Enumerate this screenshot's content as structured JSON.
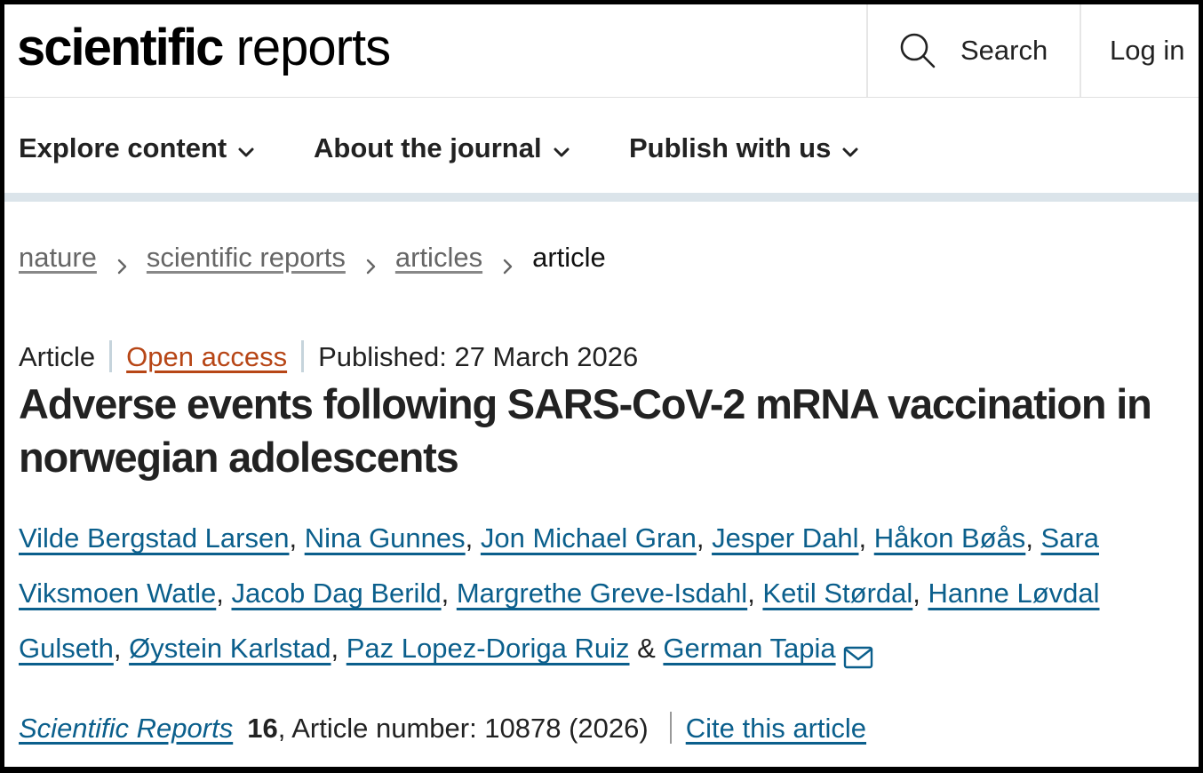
{
  "header": {
    "logo_bold": "scientific",
    "logo_light": "reports",
    "search_label": "Search",
    "login_label": "Log in"
  },
  "nav": {
    "items": [
      {
        "label": "Explore content"
      },
      {
        "label": "About the journal"
      },
      {
        "label": "Publish with us"
      }
    ]
  },
  "breadcrumb": {
    "items": [
      {
        "label": "nature"
      },
      {
        "label": "scientific reports"
      },
      {
        "label": "articles"
      }
    ],
    "current": "article"
  },
  "article": {
    "type": "Article",
    "access": "Open access",
    "published": "Published: 27 March 2026",
    "title": "Adverse events following SARS-CoV-2 mRNA vaccination in norwegian adolescents",
    "authors": [
      "Vilde Bergstad Larsen",
      "Nina Gunnes",
      "Jon Michael Gran",
      "Jesper Dahl",
      "Håkon Bøås",
      "Sara Viksmoen Watle",
      "Jacob Dag Berild",
      "Margrethe Greve-Isdahl",
      "Ketil Størdal",
      "Hanne Løvdal Gulseth",
      "Øystein Karlstad",
      "Paz Lopez-Doriga Ruiz",
      "German Tapia"
    ],
    "author_separator": ", ",
    "author_last_separator": " & ",
    "corresponding_icon": "mail-icon"
  },
  "citation": {
    "journal": "Scientific Reports",
    "volume": "16",
    "article_number": ", Article number: 10878 (2026)",
    "cite_label": "Cite this article"
  },
  "icons": {
    "search": "search-icon",
    "chevron": "chevron-down-icon",
    "breadcrumb_separator": "chevron-right-icon",
    "mail": "mail-icon"
  },
  "colors": {
    "link": "#0b5f8c",
    "open_access": "#b74616",
    "nav_rule": "#dbe4ea"
  }
}
